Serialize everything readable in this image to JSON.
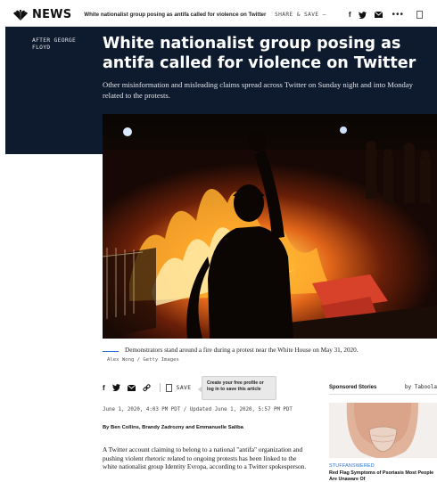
{
  "topbar": {
    "logo_text": "NEWS",
    "headline": "White nationalist group posing as antifa called for violence on Twitter",
    "share_label": "SHARE & SAVE —",
    "icons": [
      "facebook-icon",
      "twitter-icon",
      "email-icon",
      "more-icon",
      "bookmark-icon"
    ],
    "facebook_glyph": "f",
    "more_glyph": "•••"
  },
  "hero": {
    "label": "AFTER GEORGE FLOYD",
    "headline": "White nationalist group posing as antifa called for violence on Twitter",
    "dek": "Other misinformation and misleading claims spread across Twitter on Sunday night and into Monday related to the protests.",
    "background_color": "#0e1a2e"
  },
  "photo": {
    "caption": "Demonstrators stand around a fire during a protest near the White House on May 31, 2020.",
    "credit": "Alex Wong / Getty Images"
  },
  "share_row": {
    "facebook_glyph": "f",
    "save_label": "SAVE",
    "tooltip": "Create your free profile or log in to save this article"
  },
  "article": {
    "dateline": "June 1, 2020, 4:03 PM PDT / Updated June 1, 2020, 5:57 PM PDT",
    "byline": "By Ben Collins, Brandy Zadrozny and Emmanuelle Saliba",
    "body": "A Twitter account claiming to belong to a national \"antifa\" organization and pushing violent rhetoric related to ongoing protests has been linked to the white nationalist group Identity Evropa, according to a Twitter spokesperson."
  },
  "sponsored": {
    "title": "Sponsored Stories",
    "by": "by Taboola",
    "source": "STUFFANSWERED",
    "story_title": "Red Flag Symptoms of Psoriasis Most People Are Unaware Of"
  },
  "colors": {
    "accent": "#2a6fd6"
  }
}
